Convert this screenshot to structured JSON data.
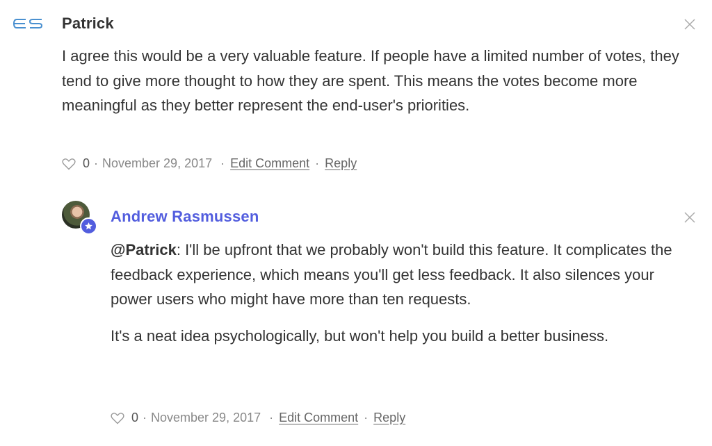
{
  "comments": [
    {
      "author": "Patrick",
      "avatar_icon": "es-logo-icon",
      "paragraphs": [
        "I agree this would be a very valuable feature. If people have a limited number of votes, they tend to give more thought to how they are spent. This means the votes become more meaningful as they better represent the end-user's priorities."
      ],
      "likes": "0",
      "separator": "·",
      "date": "November 29, 2017",
      "edit_label": "Edit Comment",
      "reply_label": "Reply"
    },
    {
      "author": "Andrew Rasmussen",
      "author_color": "#525dde",
      "badge_icon": "star-badge-icon",
      "mention": "@Patrick",
      "paragraphs": [
        ": I'll be upfront that we probably won't build this feature. It complicates the feedback experience, which means you'll get less feedback. It also silences your power users who might have more than ten requests.",
        "It's a neat idea psychologically, but won't help you build a better business."
      ],
      "likes": "0",
      "separator": "·",
      "date": "November 29, 2017",
      "edit_label": "Edit Comment",
      "reply_label": "Reply"
    }
  ]
}
